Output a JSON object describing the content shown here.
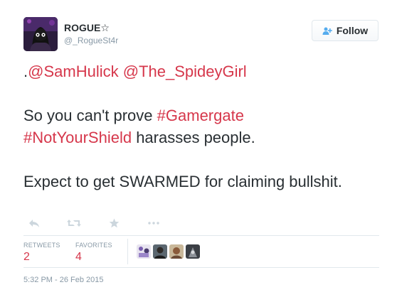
{
  "user": {
    "display_name": "ROGUE☆",
    "screen_name": "@_RogueSt4r",
    "avatar_icon": "profile-avatar"
  },
  "follow_button": {
    "label": "Follow",
    "icon": "add-user-icon"
  },
  "tweet": {
    "line1_prefix": ".",
    "mention1": "@SamHulick",
    "mention2": "@The_SpideyGirl",
    "line2_text": "So you can't prove ",
    "hashtag1": "#Gamergate",
    "hashtag2": "#NotYourShield",
    "line2_suffix": " harasses people.",
    "line3": "Expect to get SWARMED for claiming bullshit."
  },
  "actions": {
    "reply_icon": "reply-icon",
    "retweet_icon": "retweet-icon",
    "favorite_icon": "star-icon",
    "more_icon": "more-icon"
  },
  "stats": {
    "retweets_label": "RETWEETS",
    "retweets_value": "2",
    "favorites_label": "FAVORITES",
    "favorites_value": "4"
  },
  "timestamp": "5:32 PM - 26 Feb 2015",
  "colors": {
    "link": "#d6374b",
    "text": "#292f33",
    "muted": "#8899a6",
    "border": "#e1e8ed",
    "icon_muted": "#ccd6dd"
  }
}
